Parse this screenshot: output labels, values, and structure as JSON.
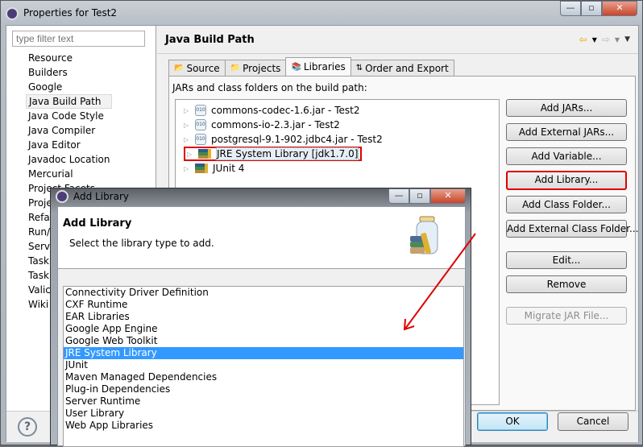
{
  "main_window": {
    "title": "Properties for Test2",
    "filter_placeholder": "type filter text",
    "nav_items": [
      "Resource",
      "Builders",
      "Google",
      "Java Build Path",
      "Java Code Style",
      "Java Compiler",
      "Java Editor",
      "Javadoc Location",
      "Mercurial",
      "Project Facets",
      "Proje",
      "Refa",
      "Run/",
      "Serv",
      "Task",
      "Task",
      "Valic",
      "Wiki"
    ],
    "selected_nav": "Java Build Path",
    "page_title": "Java Build Path",
    "tabs": [
      {
        "label": "Source",
        "icon": "source-folder-icon"
      },
      {
        "label": "Projects",
        "icon": "projects-folder-icon"
      },
      {
        "label": "Libraries",
        "icon": "libraries-icon",
        "active": true
      },
      {
        "label": "Order and Export",
        "icon": "order-export-icon"
      }
    ],
    "tab_description": "JARs and class folders on the build path:",
    "tree_items": [
      {
        "label": "commons-codec-1.6.jar - Test2",
        "icon": "jar-icon"
      },
      {
        "label": "commons-io-2.3.jar - Test2",
        "icon": "jar-icon"
      },
      {
        "label": "postgresql-9.1-902.jdbc4.jar - Test2",
        "icon": "jar-icon"
      },
      {
        "label": "JRE System Library [jdk1.7.0]",
        "icon": "library-icon",
        "highlighted": true
      },
      {
        "label": "JUnit 4",
        "icon": "library-icon"
      }
    ],
    "buttons": {
      "add_jars": "Add JARs...",
      "add_external_jars": "Add External JARs...",
      "add_variable": "Add Variable...",
      "add_library": "Add Library...",
      "add_class_folder": "Add Class Folder...",
      "add_external_class_folder": "Add External Class Folder...",
      "edit": "Edit...",
      "remove": "Remove",
      "migrate_jar": "Migrate JAR File..."
    },
    "ok": "OK",
    "cancel": "Cancel",
    "help_icon": "?"
  },
  "dialog": {
    "title": "Add Library",
    "header_title": "Add Library",
    "description": "Select the library type to add.",
    "library_types": [
      "Connectivity Driver Definition",
      "CXF Runtime",
      "EAR Libraries",
      "Google App Engine",
      "Google Web Toolkit",
      "JRE System Library",
      "JUnit",
      "Maven Managed Dependencies",
      "Plug-in Dependencies",
      "Server Runtime",
      "User Library",
      "Web App Libraries"
    ],
    "selected": "JRE System Library"
  },
  "colors": {
    "highlight_red": "#e00000",
    "selection_blue": "#3399ff"
  }
}
